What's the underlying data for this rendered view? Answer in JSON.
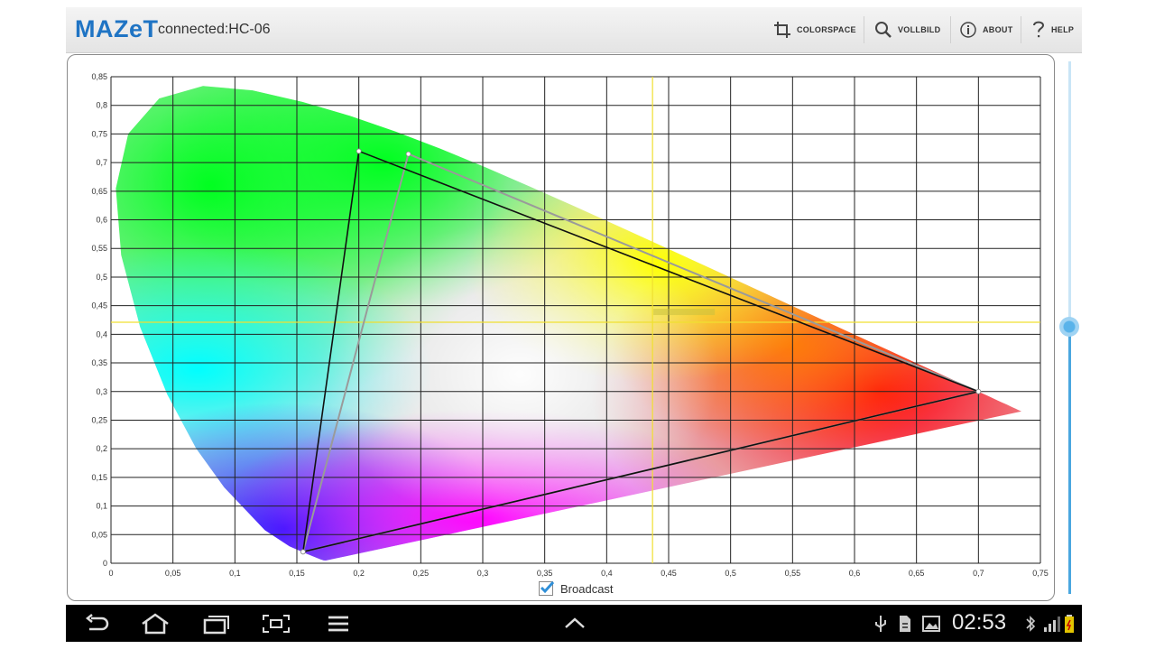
{
  "app": {
    "logo": "MAZeT",
    "status": "connected:HC-06"
  },
  "actions": [
    {
      "label": "COLORSPACE",
      "icon": "crop-icon"
    },
    {
      "label": "VOLLBILD",
      "icon": "search-icon"
    },
    {
      "label": "ABOUT",
      "icon": "info-icon"
    },
    {
      "label": "HELP",
      "icon": "question-icon"
    }
  ],
  "chart_data": {
    "type": "scatter",
    "title": "",
    "xlabel": "",
    "ylabel": "",
    "xlim": [
      0,
      0.75
    ],
    "ylim": [
      0,
      0.85
    ],
    "grid": true,
    "x_ticks": [
      "0",
      "0,05",
      "0,1",
      "0,15",
      "0,2",
      "0,25",
      "0,3",
      "0,35",
      "0,4",
      "0,45",
      "0,5",
      "0,55",
      "0,6",
      "0,65",
      "0,7",
      "0,75"
    ],
    "y_ticks": [
      "0",
      "0,05",
      "0,1",
      "0,15",
      "0,2",
      "0,25",
      "0,3",
      "0,35",
      "0,4",
      "0,45",
      "0,5",
      "0,55",
      "0,6",
      "0,65",
      "0,7",
      "0,75",
      "0,8",
      "0,85"
    ],
    "gamut_primary": [
      [
        0.2,
        0.72
      ],
      [
        0.7,
        0.3
      ],
      [
        0.155,
        0.02
      ]
    ],
    "gamut_secondary": [
      [
        0.24,
        0.715
      ],
      [
        0.7,
        0.3
      ],
      [
        0.155,
        0.02
      ]
    ],
    "measured_point": [
      0.437,
      0.421
    ],
    "crosshair_color": "#f0e030"
  },
  "broadcast": {
    "label": "Broadcast",
    "checked": true
  },
  "slider": {
    "value": 0.5
  },
  "navbar": {
    "time": "02:53"
  },
  "colors": {
    "accent": "#1f74c4",
    "slider": "#4aa7e0"
  }
}
